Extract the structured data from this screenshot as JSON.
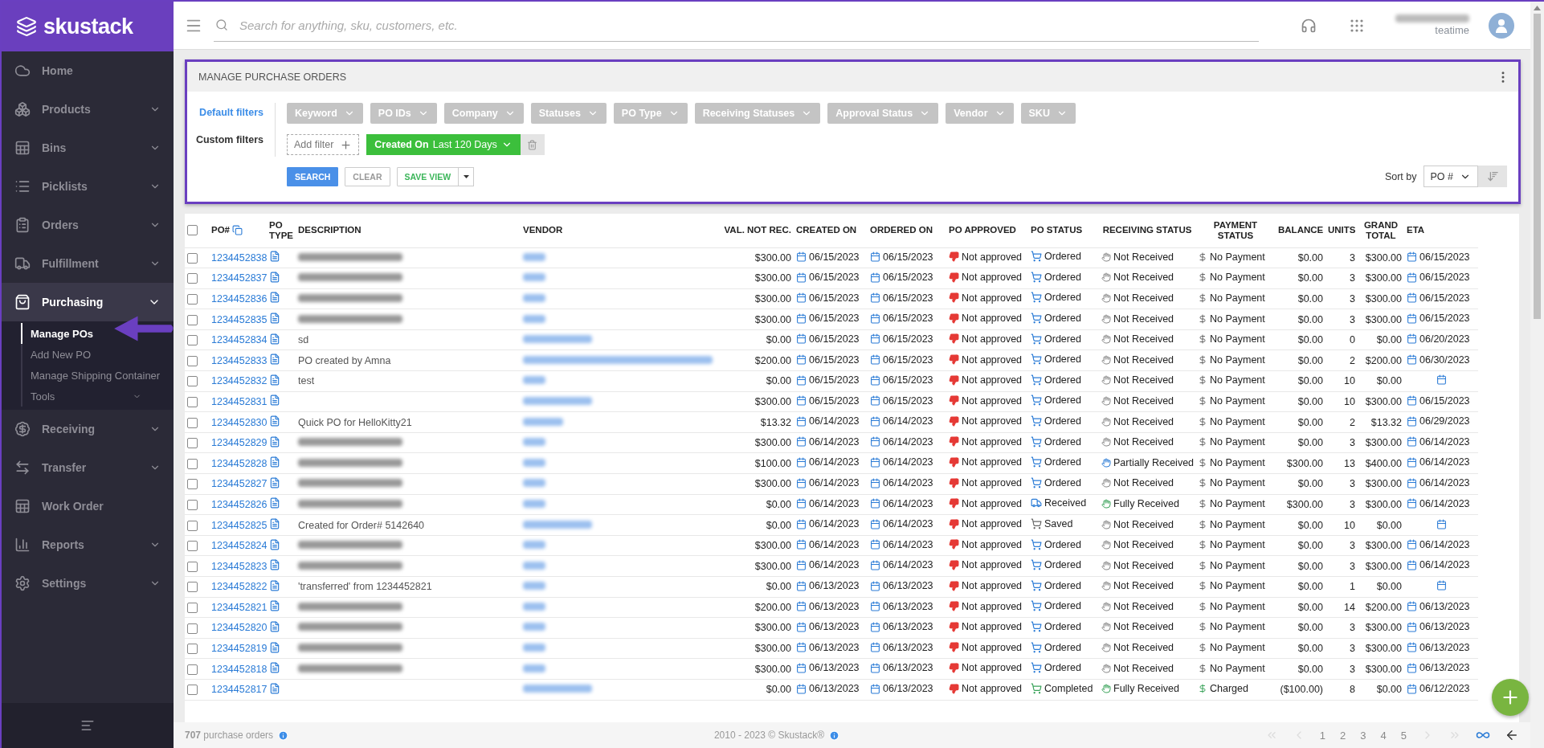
{
  "brand": "skustack",
  "sidebar": {
    "items": [
      {
        "label": "Home",
        "selected": false
      },
      {
        "label": "Products",
        "selected": false,
        "expanded": false
      },
      {
        "label": "Bins",
        "selected": false,
        "expanded": false
      },
      {
        "label": "Picklists",
        "selected": false,
        "expanded": false
      },
      {
        "label": "Orders",
        "selected": false,
        "expanded": false
      },
      {
        "label": "Fulfillment",
        "selected": false,
        "expanded": false
      },
      {
        "label": "Purchasing",
        "selected": true,
        "expanded": true,
        "children": [
          {
            "label": "Manage POs",
            "selected": true
          },
          {
            "label": "Add New PO",
            "selected": false
          },
          {
            "label": "Manage Shipping Container",
            "selected": false
          },
          {
            "label": "Tools",
            "selected": false,
            "expanded": false
          }
        ]
      },
      {
        "label": "Receiving",
        "selected": false,
        "expanded": false
      },
      {
        "label": "Transfer",
        "selected": false,
        "expanded": false
      },
      {
        "label": "Work Order",
        "selected": false
      },
      {
        "label": "Reports",
        "selected": false,
        "expanded": false
      },
      {
        "label": "Settings",
        "selected": false,
        "expanded": false
      }
    ]
  },
  "search": {
    "placeholder": "Search for anything, sku, customers, etc."
  },
  "user": {
    "name_redacted": true,
    "company": "teatime"
  },
  "panel": {
    "title": "MANAGE PURCHASE ORDERS",
    "filter_modes": [
      {
        "label": "Default filters",
        "selected": true
      },
      {
        "label": "Custom filters",
        "selected": false
      }
    ],
    "default_filters": [
      "Keyword",
      "PO IDs",
      "Company",
      "Statuses",
      "PO Type",
      "Receiving Statuses",
      "Approval Status",
      "Vendor",
      "SKU"
    ],
    "add_filter": "Add filter",
    "custom_filter": {
      "field": "Created On",
      "value": "Last 120 Days"
    },
    "buttons": [
      "SEARCH",
      "CLEAR",
      "SAVE VIEW"
    ],
    "sort_label": "Sort by",
    "sort_value": "PO #"
  },
  "table": {
    "columns": [
      "PO#",
      "PO TYPE",
      "DESCRIPTION",
      "VENDOR",
      "VAL. NOT REC.",
      "CREATED ON",
      "ORDERED ON",
      "PO APPROVED",
      "PO STATUS",
      "RECEIVING STATUS",
      "PAYMENT STATUS",
      "BALANCE",
      "UNITS",
      "GRAND TOTAL",
      "ETA"
    ],
    "header_checked": false,
    "rows": [
      {
        "checked": false,
        "po": "1234452838",
        "desc_redacted": true,
        "vendor_redacted": true,
        "val": "$300.00",
        "created": "06/15/2023",
        "ordered": "06/15/2023",
        "approval": "Not approved",
        "status": {
          "kind": "ordered",
          "label": "Ordered"
        },
        "receiving": {
          "kind": "none",
          "label": "Not Received"
        },
        "payment": {
          "kind": "none",
          "label": "No Payment"
        },
        "balance": "$0.00",
        "units": "3",
        "total": "$300.00",
        "eta": "06/15/2023"
      },
      {
        "checked": false,
        "po": "1234452837",
        "desc_redacted": true,
        "vendor_redacted": true,
        "val": "$300.00",
        "created": "06/15/2023",
        "ordered": "06/15/2023",
        "approval": "Not approved",
        "status": {
          "kind": "ordered",
          "label": "Ordered"
        },
        "receiving": {
          "kind": "none",
          "label": "Not Received"
        },
        "payment": {
          "kind": "none",
          "label": "No Payment"
        },
        "balance": "$0.00",
        "units": "3",
        "total": "$300.00",
        "eta": "06/15/2023"
      },
      {
        "checked": false,
        "po": "1234452836",
        "desc_redacted": true,
        "vendor_redacted": true,
        "val": "$300.00",
        "created": "06/15/2023",
        "ordered": "06/15/2023",
        "approval": "Not approved",
        "status": {
          "kind": "ordered",
          "label": "Ordered"
        },
        "receiving": {
          "kind": "none",
          "label": "Not Received"
        },
        "payment": {
          "kind": "none",
          "label": "No Payment"
        },
        "balance": "$0.00",
        "units": "3",
        "total": "$300.00",
        "eta": "06/15/2023"
      },
      {
        "checked": false,
        "po": "1234452835",
        "desc_redacted": true,
        "vendor_redacted": true,
        "val": "$300.00",
        "created": "06/15/2023",
        "ordered": "06/15/2023",
        "approval": "Not approved",
        "status": {
          "kind": "ordered",
          "label": "Ordered"
        },
        "receiving": {
          "kind": "none",
          "label": "Not Received"
        },
        "payment": {
          "kind": "none",
          "label": "No Payment"
        },
        "balance": "$0.00",
        "units": "3",
        "total": "$300.00",
        "eta": "06/15/2023"
      },
      {
        "checked": false,
        "po": "1234452834",
        "desc": "sd",
        "vendor_redacted": true,
        "val": "$0.00",
        "created": "06/15/2023",
        "ordered": "06/15/2023",
        "approval": "Not approved",
        "status": {
          "kind": "ordered",
          "label": "Ordered"
        },
        "receiving": {
          "kind": "none",
          "label": "Not Received"
        },
        "payment": {
          "kind": "none",
          "label": "No Payment"
        },
        "balance": "$0.00",
        "units": "0",
        "total": "$0.00",
        "eta": "06/20/2023"
      },
      {
        "checked": false,
        "po": "1234452833",
        "desc": "PO created by Amna",
        "vendor_redacted": true,
        "val": "$200.00",
        "created": "06/15/2023",
        "ordered": "06/15/2023",
        "approval": "Not approved",
        "status": {
          "kind": "ordered",
          "label": "Ordered"
        },
        "receiving": {
          "kind": "none",
          "label": "Not Received"
        },
        "payment": {
          "kind": "none",
          "label": "No Payment"
        },
        "balance": "$0.00",
        "units": "2",
        "total": "$200.00",
        "eta": "06/30/2023"
      },
      {
        "checked": false,
        "po": "1234452832",
        "desc": "test",
        "vendor_redacted": true,
        "val": "$0.00",
        "created": "06/15/2023",
        "ordered": "06/15/2023",
        "approval": "Not approved",
        "status": {
          "kind": "ordered",
          "label": "Ordered"
        },
        "receiving": {
          "kind": "none",
          "label": "Not Received"
        },
        "payment": {
          "kind": "none",
          "label": "No Payment"
        },
        "balance": "$0.00",
        "units": "10",
        "total": "$0.00"
      },
      {
        "checked": false,
        "po": "1234452831",
        "vendor_redacted": true,
        "val": "$300.00",
        "created": "06/15/2023",
        "ordered": "06/15/2023",
        "approval": "Not approved",
        "status": {
          "kind": "ordered",
          "label": "Ordered"
        },
        "receiving": {
          "kind": "none",
          "label": "Not Received"
        },
        "payment": {
          "kind": "none",
          "label": "No Payment"
        },
        "balance": "$0.00",
        "units": "10",
        "total": "$300.00",
        "eta": "06/15/2023"
      },
      {
        "checked": false,
        "po": "1234452830",
        "desc": "Quick PO for HelloKitty21",
        "vendor_redacted": true,
        "val": "$13.32",
        "created": "06/14/2023",
        "ordered": "06/14/2023",
        "approval": "Not approved",
        "status": {
          "kind": "ordered",
          "label": "Ordered"
        },
        "receiving": {
          "kind": "none",
          "label": "Not Received"
        },
        "payment": {
          "kind": "none",
          "label": "No Payment"
        },
        "balance": "$0.00",
        "units": "2",
        "total": "$13.32",
        "eta": "06/29/2023"
      },
      {
        "checked": false,
        "po": "1234452829",
        "desc_redacted": true,
        "vendor_redacted": true,
        "val": "$300.00",
        "created": "06/14/2023",
        "ordered": "06/14/2023",
        "approval": "Not approved",
        "status": {
          "kind": "ordered",
          "label": "Ordered"
        },
        "receiving": {
          "kind": "none",
          "label": "Not Received"
        },
        "payment": {
          "kind": "none",
          "label": "No Payment"
        },
        "balance": "$0.00",
        "units": "3",
        "total": "$300.00",
        "eta": "06/14/2023"
      },
      {
        "checked": false,
        "po": "1234452828",
        "desc_redacted": true,
        "vendor_redacted": true,
        "val": "$100.00",
        "created": "06/14/2023",
        "ordered": "06/14/2023",
        "approval": "Not approved",
        "status": {
          "kind": "ordered",
          "label": "Ordered"
        },
        "receiving": {
          "kind": "partial",
          "label": "Partially Received"
        },
        "payment": {
          "kind": "none",
          "label": "No Payment"
        },
        "balance": "$300.00",
        "units": "13",
        "total": "$400.00",
        "eta": "06/14/2023"
      },
      {
        "checked": false,
        "po": "1234452827",
        "desc_redacted": true,
        "vendor_redacted": true,
        "val": "$300.00",
        "created": "06/14/2023",
        "ordered": "06/14/2023",
        "approval": "Not approved",
        "status": {
          "kind": "ordered",
          "label": "Ordered"
        },
        "receiving": {
          "kind": "none",
          "label": "Not Received"
        },
        "payment": {
          "kind": "none",
          "label": "No Payment"
        },
        "balance": "$0.00",
        "units": "3",
        "total": "$300.00",
        "eta": "06/14/2023"
      },
      {
        "checked": false,
        "po": "1234452826",
        "desc_redacted": true,
        "vendor_redacted": true,
        "val": "$0.00",
        "created": "06/14/2023",
        "ordered": "06/14/2023",
        "approval": "Not approved",
        "status": {
          "kind": "received",
          "label": "Received"
        },
        "receiving": {
          "kind": "full",
          "label": "Fully Received"
        },
        "payment": {
          "kind": "none",
          "label": "No Payment"
        },
        "balance": "$300.00",
        "units": "3",
        "total": "$300.00",
        "eta": "06/14/2023"
      },
      {
        "checked": false,
        "po": "1234452825",
        "desc": "Created for Order# 5142640",
        "vendor_redacted": true,
        "val": "$0.00",
        "created": "06/14/2023",
        "ordered": "06/14/2023",
        "approval": "Not approved",
        "status": {
          "kind": "saved",
          "label": "Saved"
        },
        "receiving": {
          "kind": "none",
          "label": "Not Received"
        },
        "payment": {
          "kind": "none",
          "label": "No Payment"
        },
        "balance": "$0.00",
        "units": "10",
        "total": "$0.00"
      },
      {
        "checked": false,
        "po": "1234452824",
        "desc_redacted": true,
        "vendor_redacted": true,
        "val": "$300.00",
        "created": "06/14/2023",
        "ordered": "06/14/2023",
        "approval": "Not approved",
        "status": {
          "kind": "ordered",
          "label": "Ordered"
        },
        "receiving": {
          "kind": "none",
          "label": "Not Received"
        },
        "payment": {
          "kind": "none",
          "label": "No Payment"
        },
        "balance": "$0.00",
        "units": "3",
        "total": "$300.00",
        "eta": "06/14/2023"
      },
      {
        "checked": false,
        "po": "1234452823",
        "desc_redacted": true,
        "vendor_redacted": true,
        "val": "$300.00",
        "created": "06/14/2023",
        "ordered": "06/14/2023",
        "approval": "Not approved",
        "status": {
          "kind": "ordered",
          "label": "Ordered"
        },
        "receiving": {
          "kind": "none",
          "label": "Not Received"
        },
        "payment": {
          "kind": "none",
          "label": "No Payment"
        },
        "balance": "$0.00",
        "units": "3",
        "total": "$300.00",
        "eta": "06/14/2023"
      },
      {
        "checked": false,
        "po": "1234452822",
        "desc": "'transferred' from 1234452821",
        "vendor_redacted": true,
        "val": "$0.00",
        "created": "06/13/2023",
        "ordered": "06/13/2023",
        "approval": "Not approved",
        "status": {
          "kind": "ordered",
          "label": "Ordered"
        },
        "receiving": {
          "kind": "none",
          "label": "Not Received"
        },
        "payment": {
          "kind": "none",
          "label": "No Payment"
        },
        "balance": "$0.00",
        "units": "1",
        "total": "$0.00"
      },
      {
        "checked": false,
        "po": "1234452821",
        "desc_redacted": true,
        "vendor_redacted": true,
        "val": "$200.00",
        "created": "06/13/2023",
        "ordered": "06/13/2023",
        "approval": "Not approved",
        "status": {
          "kind": "ordered",
          "label": "Ordered"
        },
        "receiving": {
          "kind": "none",
          "label": "Not Received"
        },
        "payment": {
          "kind": "none",
          "label": "No Payment"
        },
        "balance": "$0.00",
        "units": "14",
        "total": "$200.00",
        "eta": "06/13/2023"
      },
      {
        "checked": false,
        "po": "1234452820",
        "desc_redacted": true,
        "vendor_redacted": true,
        "val": "$300.00",
        "created": "06/13/2023",
        "ordered": "06/13/2023",
        "approval": "Not approved",
        "status": {
          "kind": "ordered",
          "label": "Ordered"
        },
        "receiving": {
          "kind": "none",
          "label": "Not Received"
        },
        "payment": {
          "kind": "none",
          "label": "No Payment"
        },
        "balance": "$0.00",
        "units": "3",
        "total": "$300.00",
        "eta": "06/13/2023"
      },
      {
        "checked": false,
        "po": "1234452819",
        "desc_redacted": true,
        "vendor_redacted": true,
        "val": "$300.00",
        "created": "06/13/2023",
        "ordered": "06/13/2023",
        "approval": "Not approved",
        "status": {
          "kind": "ordered",
          "label": "Ordered"
        },
        "receiving": {
          "kind": "none",
          "label": "Not Received"
        },
        "payment": {
          "kind": "none",
          "label": "No Payment"
        },
        "balance": "$0.00",
        "units": "3",
        "total": "$300.00",
        "eta": "06/13/2023"
      },
      {
        "checked": false,
        "po": "1234452818",
        "desc_redacted": true,
        "vendor_redacted": true,
        "val": "$300.00",
        "created": "06/13/2023",
        "ordered": "06/13/2023",
        "approval": "Not approved",
        "status": {
          "kind": "ordered",
          "label": "Ordered"
        },
        "receiving": {
          "kind": "none",
          "label": "Not Received"
        },
        "payment": {
          "kind": "none",
          "label": "No Payment"
        },
        "balance": "$0.00",
        "units": "3",
        "total": "$300.00",
        "eta": "06/13/2023"
      },
      {
        "checked": false,
        "po": "1234452817",
        "vendor_redacted": true,
        "val": "$0.00",
        "created": "06/13/2023",
        "ordered": "06/13/2023",
        "approval": "Not approved",
        "status": {
          "kind": "completed",
          "label": "Completed"
        },
        "receiving": {
          "kind": "full",
          "label": "Fully Received"
        },
        "payment": {
          "kind": "charged",
          "label": "Charged"
        },
        "balance": "($100.00)",
        "units": "8",
        "total": "$0.00",
        "eta": "06/12/2023"
      }
    ]
  },
  "footer": {
    "count": "**707** purchase orders",
    "copyright": "2010 - 2023 © Skustack®",
    "pages": [
      {
        "label": "1",
        "disabled": true
      },
      {
        "label": "2",
        "disabled": true
      },
      {
        "label": "3",
        "disabled": true
      },
      {
        "label": "4",
        "disabled": true
      },
      {
        "label": "5",
        "disabled": true
      }
    ]
  }
}
